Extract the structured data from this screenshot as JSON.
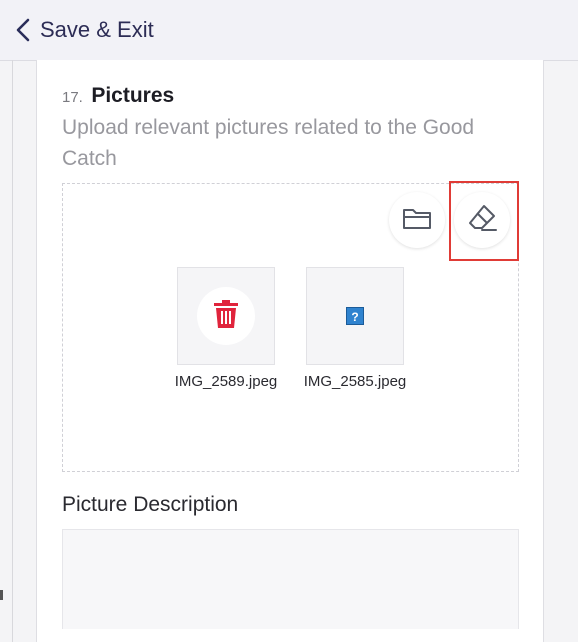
{
  "header": {
    "back_label": "Save & Exit"
  },
  "question": {
    "number": "17.",
    "title": "Pictures",
    "description": "Upload relevant pictures related to the Good Catch"
  },
  "pictures": [
    {
      "filename": "IMG_2589.jpeg",
      "state": "loaded",
      "action_icon": "trash-icon"
    },
    {
      "filename": "IMG_2585.jpeg",
      "state": "broken",
      "action_icon": "broken-image-icon"
    }
  ],
  "toolbar": {
    "browse_icon": "folder-icon",
    "clear_icon": "eraser-icon"
  },
  "picture_description": {
    "label": "Picture Description",
    "value": ""
  },
  "colors": {
    "accent_navy": "#2a2d5a",
    "delete_red": "#e0243c",
    "highlight_red": "#e03b36"
  }
}
